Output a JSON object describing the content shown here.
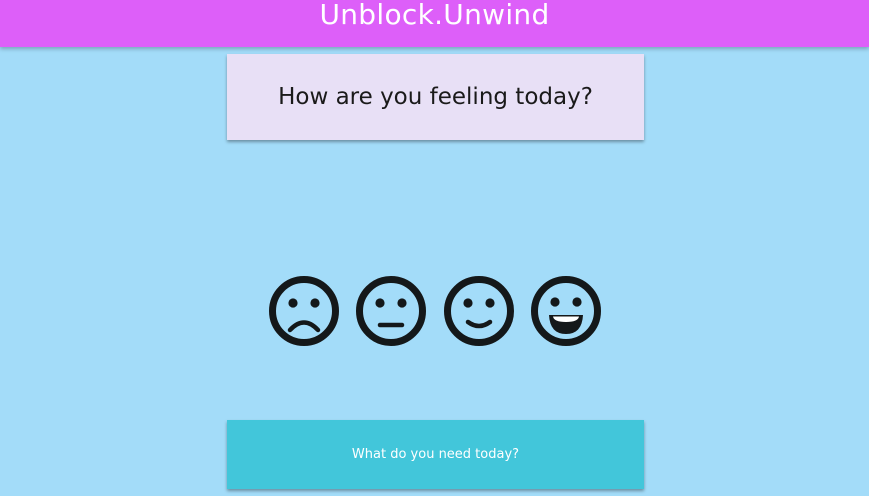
{
  "header": {
    "title": "Unblock.Unwind"
  },
  "prompt": {
    "question": "How are you feeling today?"
  },
  "moods": [
    {
      "icon": "sad-face-icon"
    },
    {
      "icon": "neutral-face-icon"
    },
    {
      "icon": "slight-smile-face-icon"
    },
    {
      "icon": "grinning-face-icon"
    }
  ],
  "actions": {
    "need_label": "What do you need today?"
  },
  "colors": {
    "background": "#a3dcf9",
    "header": "#dd5ff9",
    "card": "#e8e0f6",
    "button": "#42c6da",
    "icon": "#14181a"
  }
}
